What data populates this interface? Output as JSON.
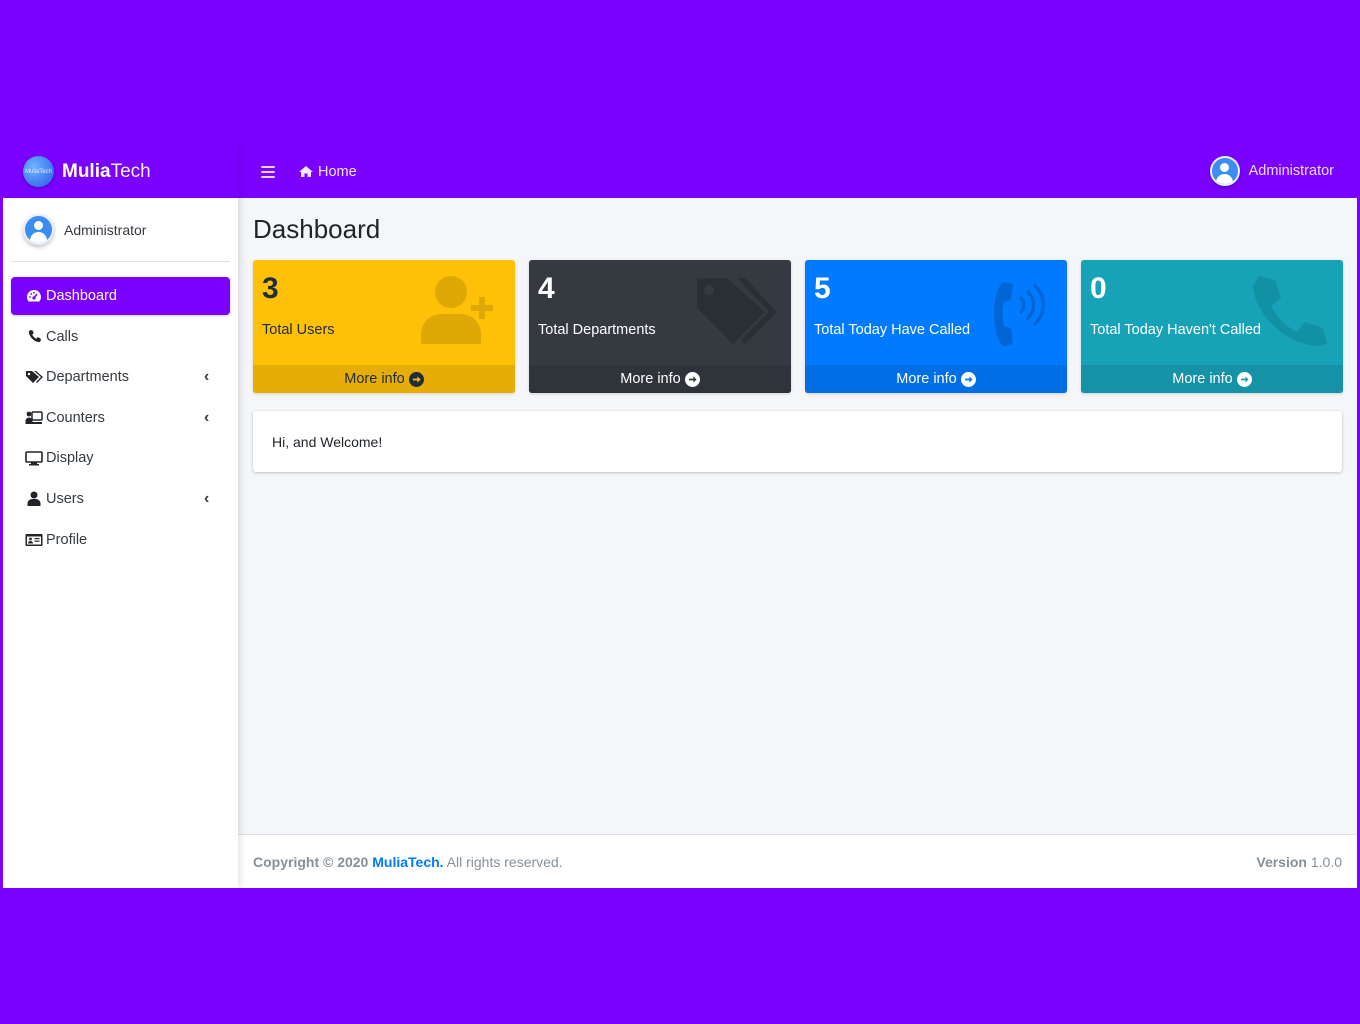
{
  "brand": {
    "name_bold": "Mulia",
    "name_light": "Tech",
    "logo_text": "MuliaTech"
  },
  "sidebar": {
    "user_name": "Administrator",
    "items": [
      {
        "label": "Dashboard",
        "icon": "tachometer-icon"
      },
      {
        "label": "Calls",
        "icon": "phone-icon"
      },
      {
        "label": "Departments",
        "icon": "tags-icon",
        "has_submenu": true
      },
      {
        "label": "Counters",
        "icon": "counter-icon",
        "has_submenu": true
      },
      {
        "label": "Display",
        "icon": "desktop-icon"
      },
      {
        "label": "Users",
        "icon": "user-icon",
        "has_submenu": true
      },
      {
        "label": "Profile",
        "icon": "id-card-icon"
      }
    ],
    "caret": "‹"
  },
  "topnav": {
    "home_label": "Home",
    "user_name": "Administrator"
  },
  "page": {
    "title": "Dashboard"
  },
  "stats": [
    {
      "value": "3",
      "label": "Total Users",
      "footer": "More info",
      "icon": "user-plus-icon",
      "color": "#ffc107"
    },
    {
      "value": "4",
      "label": "Total Departments",
      "footer": "More info",
      "icon": "tags-icon",
      "color": "#343a40"
    },
    {
      "value": "5",
      "label": "Total Today Have Called",
      "footer": "More info",
      "icon": "phone-volume-icon",
      "color": "#007bff"
    },
    {
      "value": "0",
      "label": "Total Today Haven't Called",
      "footer": "More info",
      "icon": "phone-icon",
      "color": "#17a2b8"
    }
  ],
  "welcome": {
    "text": "Hi, and Welcome!"
  },
  "footer": {
    "copyright": "Copyright © 2020",
    "company": "MuliaTech.",
    "rights": "All rights reserved.",
    "version_label": "Version",
    "version": "1.0.0"
  },
  "colors": {
    "accent": "#7a00ff",
    "link": "#007bff"
  }
}
